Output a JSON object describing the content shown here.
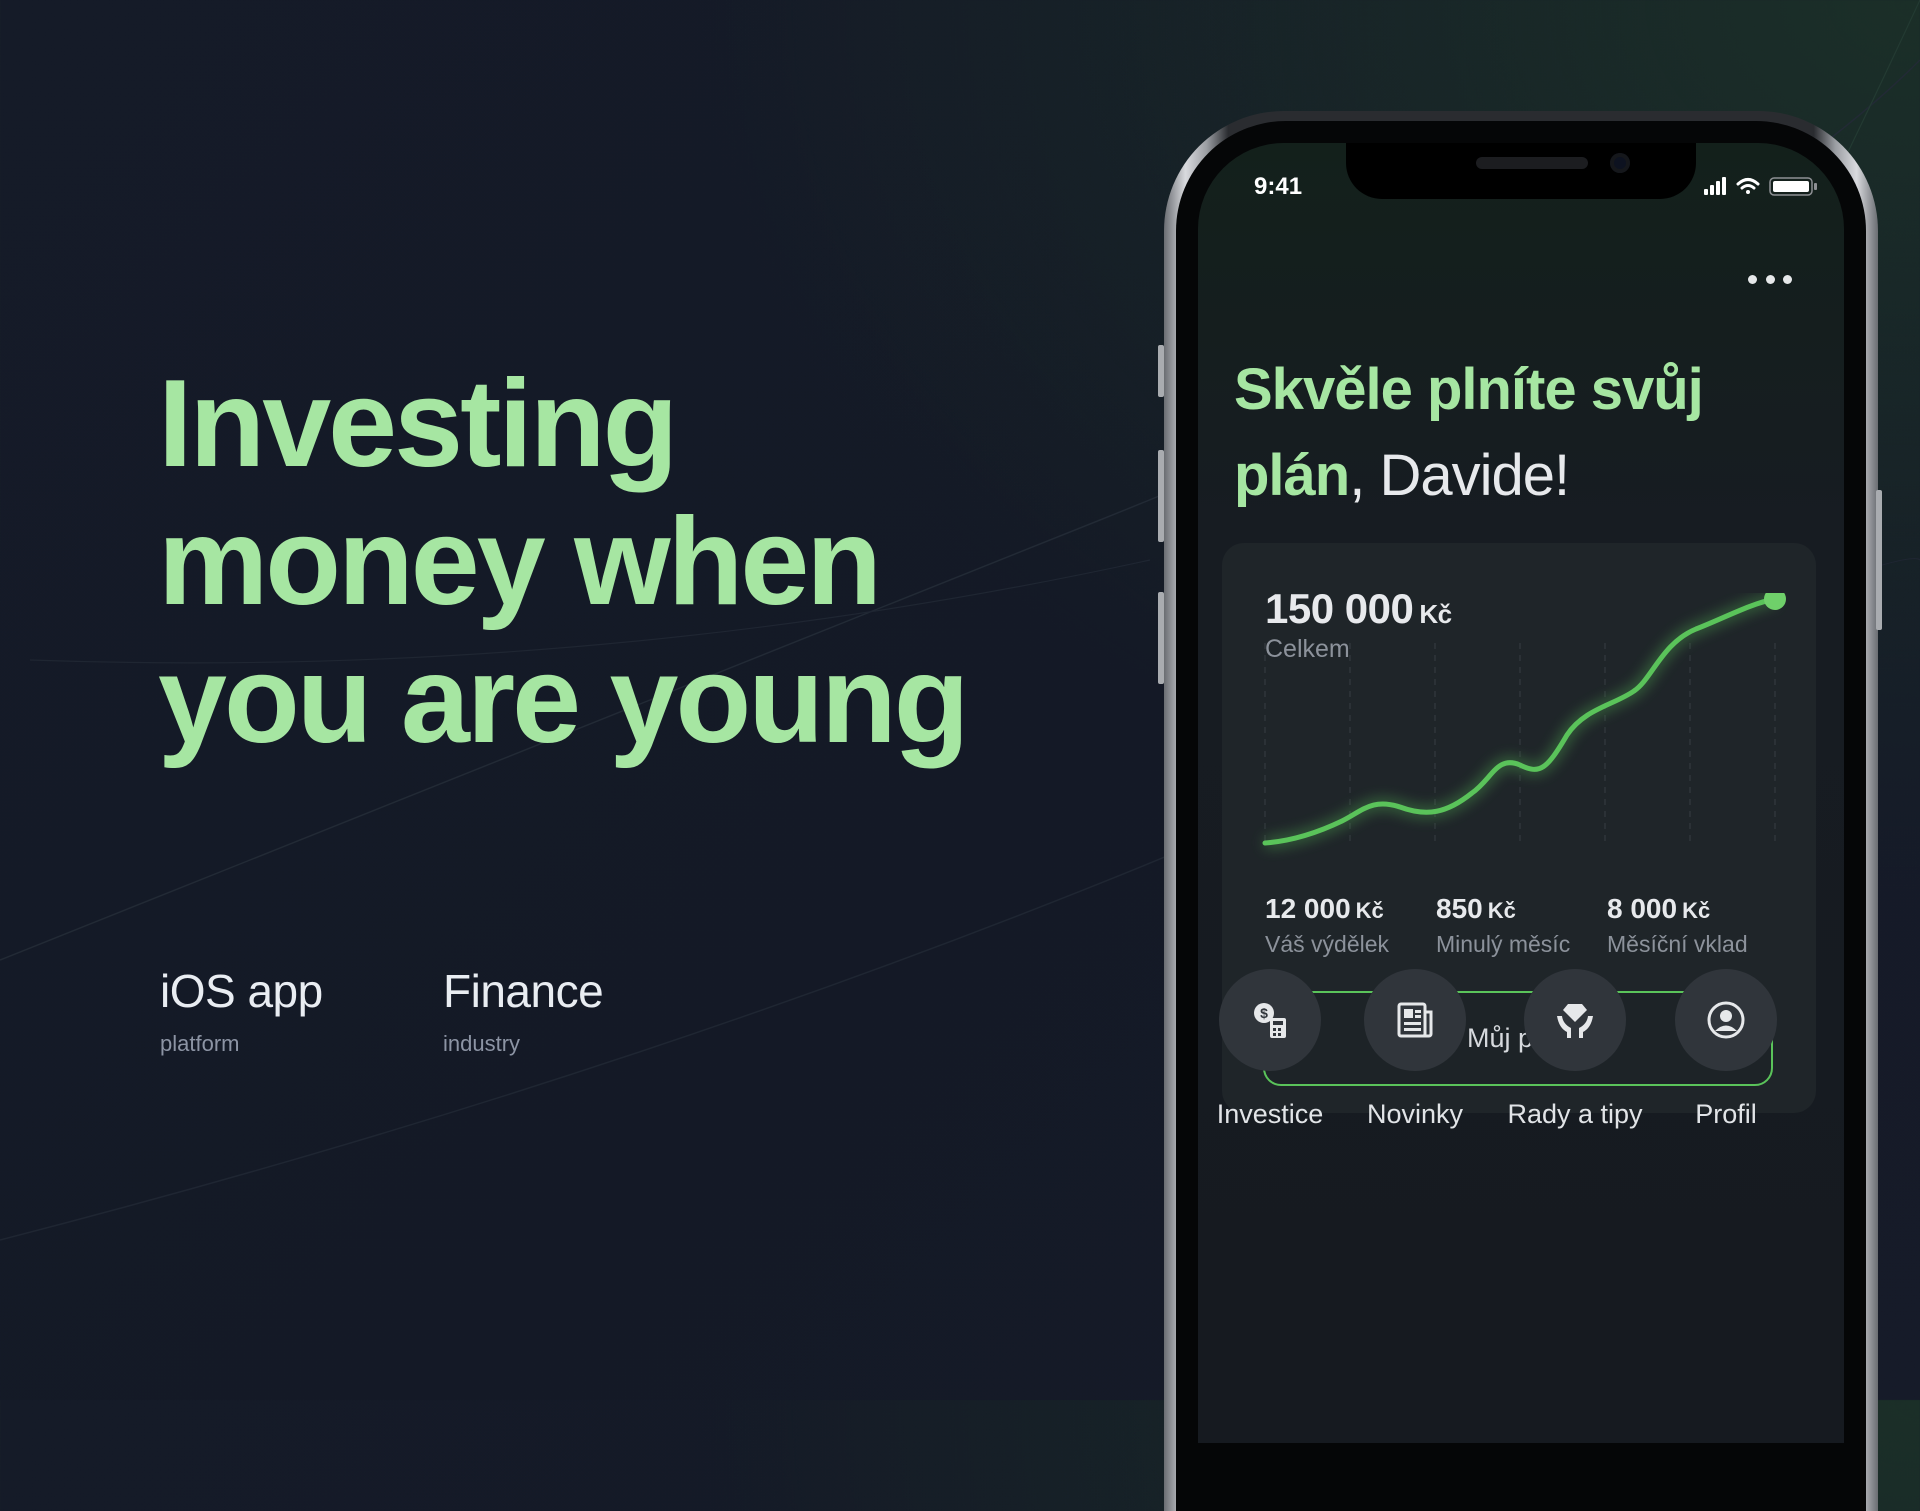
{
  "headline": {
    "lines": [
      "Investing",
      "money when",
      "you are young"
    ]
  },
  "meta": {
    "platform": {
      "value": "iOS app",
      "label": "platform"
    },
    "industry": {
      "value": "Finance",
      "label": "industry"
    }
  },
  "phone": {
    "status": {
      "time": "9:41"
    },
    "greeting": {
      "highlight": "Skvěle plníte svůj plán",
      "rest": ", Davide!"
    },
    "card": {
      "total": "150 000",
      "currency": "Kč",
      "total_label": "Celkem",
      "stats": [
        {
          "value": "12 000",
          "currency": "Kč",
          "label": "Váš výdělek"
        },
        {
          "value": "850",
          "currency": "Kč",
          "label": "Minulý měsíc"
        },
        {
          "value": "8 000",
          "currency": "Kč",
          "label": "Měsíční vklad"
        }
      ],
      "plan_button": "Můj plán"
    },
    "nav": [
      {
        "label": "Investice",
        "icon": "investment-icon"
      },
      {
        "label": "Novinky",
        "icon": "news-icon"
      },
      {
        "label": "Rady a tipy",
        "icon": "tips-icon"
      },
      {
        "label": "Profil",
        "icon": "profile-icon"
      }
    ]
  },
  "colors": {
    "accent": "#a6e6a2",
    "chart_line": "#5ac35a",
    "background": "#151b28"
  }
}
